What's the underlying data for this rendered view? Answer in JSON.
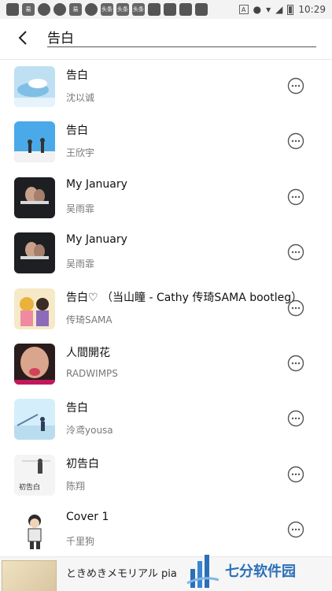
{
  "status_bar": {
    "time": "10:29",
    "left_icons": [
      "易",
      "头条",
      "头条",
      "头条"
    ],
    "a_icon": "A"
  },
  "header": {
    "search_value": "告白"
  },
  "songs": [
    {
      "title": "告白",
      "artist": "沈以诚"
    },
    {
      "title": "告白",
      "artist": "王欣宇"
    },
    {
      "title": "My January",
      "artist": "吴雨霏"
    },
    {
      "title": "My January",
      "artist": "吴雨霏"
    },
    {
      "title": "告白♡ （当山瞳 - Cathy 传琦SAMA bootleg）",
      "artist": "传琦SAMA"
    },
    {
      "title": "人間開花",
      "artist": "RADWIMPS"
    },
    {
      "title": "告白",
      "artist": "泠鸢yousa"
    },
    {
      "title": "初告白",
      "artist": "陈翔"
    },
    {
      "title": "Cover 1",
      "artist": "千里狗"
    }
  ],
  "cover_texts": {
    "cover_8": "初告白"
  },
  "player": {
    "title": "ときめきメモリアル pia"
  },
  "watermark": {
    "text": "七分软件园"
  }
}
